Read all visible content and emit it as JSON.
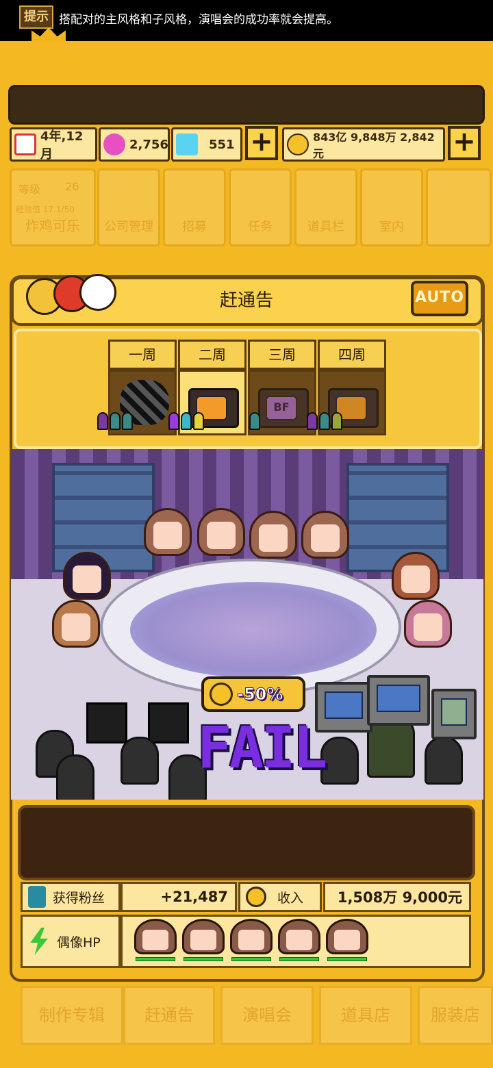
{
  "tip": {
    "badge": "提示",
    "text": "搭配对的主风格和子风格，演唱会的成功率就会提高。"
  },
  "resources": {
    "date": "4年,12月",
    "gems": "2,756",
    "diamonds": "551",
    "money": "843亿 9,848万 2,842元",
    "plus_symbol": "+"
  },
  "background_menu": {
    "level_label": "等级",
    "level_value": "26",
    "exp_label": "经验值 17.1/50",
    "company_name": "炸鸡可乐",
    "items": [
      "公司管理",
      "招募",
      "任务",
      "道具栏",
      "室内"
    ]
  },
  "panel": {
    "title": "赶通告",
    "auto_label": "AUTO"
  },
  "weeks": {
    "tabs": [
      "一周",
      "二周",
      "三周",
      "四周"
    ],
    "selected_index": 1,
    "tv_icon_3": "BF"
  },
  "scene": {
    "penalty": "-50%",
    "fail_text": "FAIL"
  },
  "stats": {
    "fans_label": "获得粉丝",
    "fans_value": "+21,487",
    "income_label": "收入",
    "income_value": "1,508万 9,000元",
    "hp_label": "偶像HP",
    "idol_count": 5
  },
  "bottom_nav": [
    "制作专辑",
    "赶通告",
    "演唱会",
    "道具店",
    "服装店"
  ],
  "colors": {
    "background": "#f4b823",
    "dark_brown": "#3d2410",
    "fail_purple": "#7a2ee0",
    "hp_green": "#35c93a"
  }
}
